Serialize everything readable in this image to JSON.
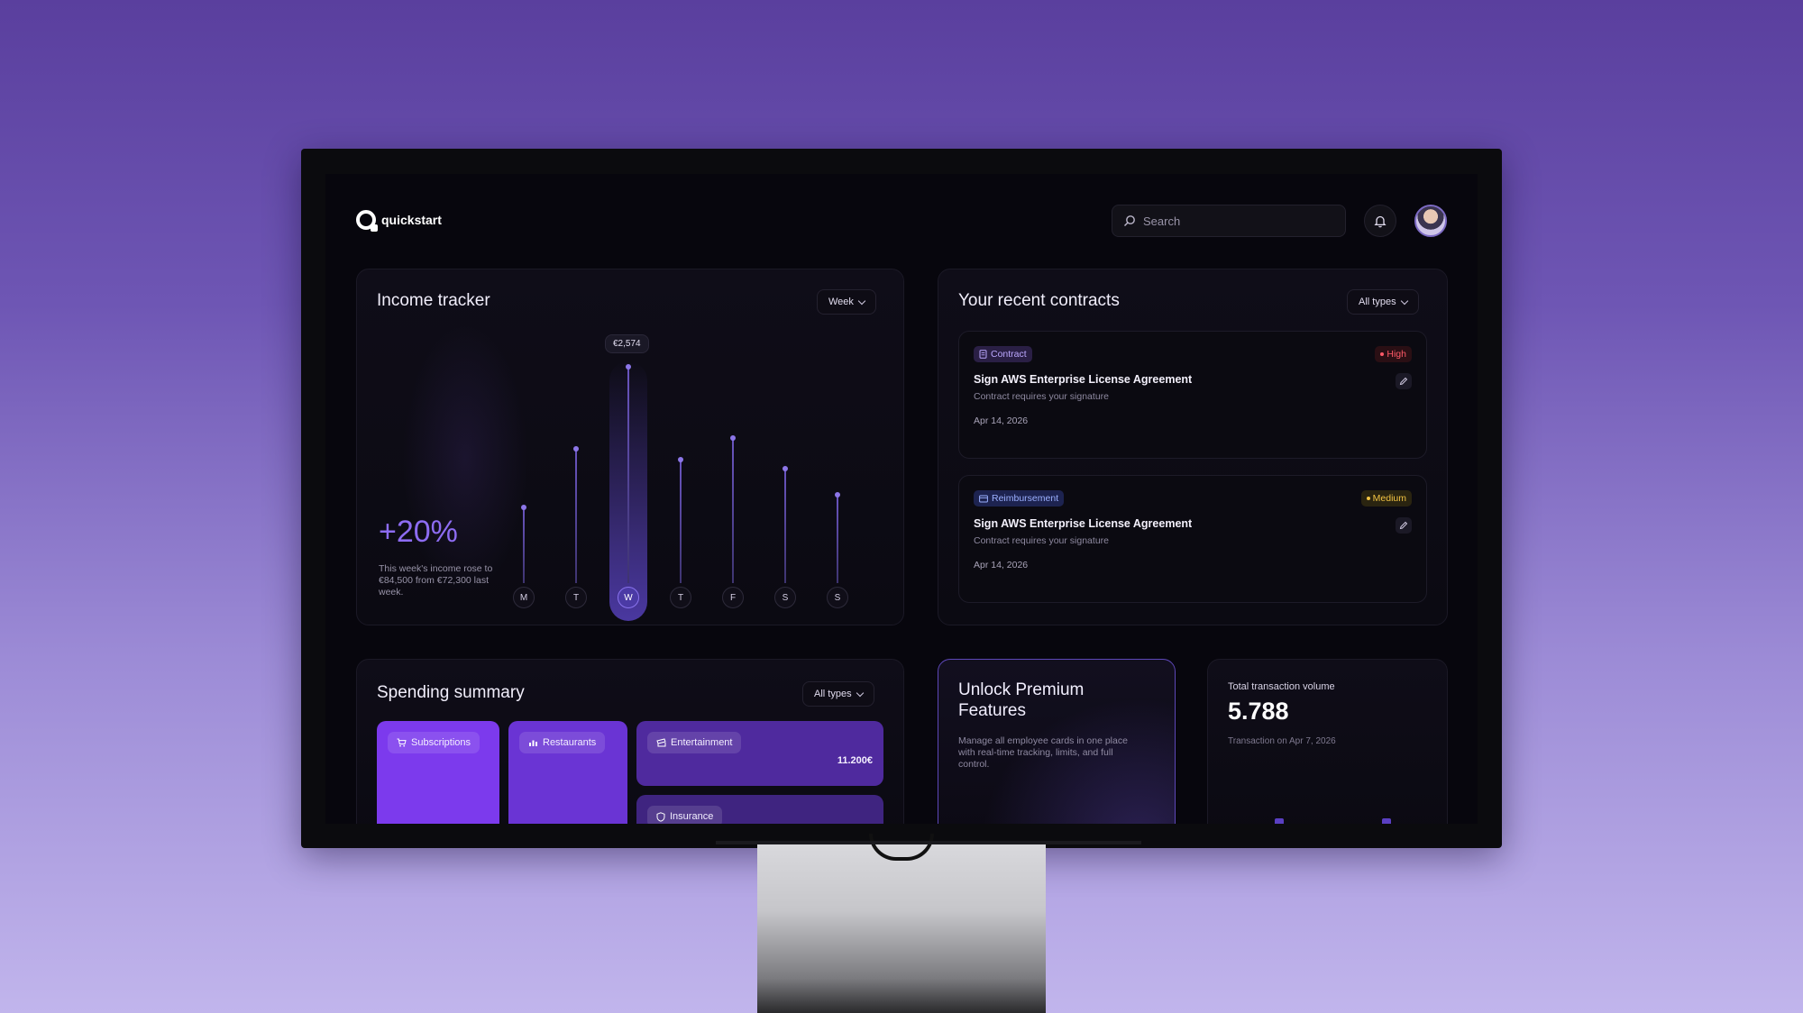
{
  "header": {
    "brand": "quickstart",
    "search_placeholder": "Search"
  },
  "income_tracker": {
    "title": "Income tracker",
    "period": "Week",
    "change": "+20%",
    "description": "This week's income rose to €84,500 from €72,300 last week.",
    "tooltip": "€2,574",
    "days": [
      {
        "label": "M",
        "level": 0.35
      },
      {
        "label": "T",
        "level": 0.62
      },
      {
        "label": "W",
        "level": 1.0,
        "active": true
      },
      {
        "label": "T",
        "level": 0.57
      },
      {
        "label": "F",
        "level": 0.67
      },
      {
        "label": "S",
        "level": 0.53
      },
      {
        "label": "S",
        "level": 0.41
      }
    ]
  },
  "contracts": {
    "title": "Your recent contracts",
    "filter": "All types",
    "items": [
      {
        "type": "Contract",
        "priority": "High",
        "title": "Sign AWS Enterprise License Agreement",
        "subtitle": "Contract requires your signature",
        "date": "Apr 14, 2026"
      },
      {
        "type": "Reimbursement",
        "priority": "Medium",
        "title": "Sign AWS Enterprise License Agreement",
        "subtitle": "Contract requires your signature",
        "date": "Apr 14, 2026"
      }
    ]
  },
  "spending": {
    "title": "Spending summary",
    "filter": "All types",
    "categories": [
      {
        "label": "Subscriptions",
        "value": "",
        "color": "#7c3aed"
      },
      {
        "label": "Restaurants",
        "value": "",
        "color": "#6a34d4"
      },
      {
        "label": "Entertainment",
        "value": "11.200€",
        "color": "#4f2a9e"
      },
      {
        "label": "Insurance",
        "value": "",
        "color": "#3f2480"
      }
    ]
  },
  "premium": {
    "title": "Unlock Premium Features",
    "description": "Manage all employee cards in one place with real-time tracking, limits, and full control."
  },
  "volume": {
    "label": "Total transaction volume",
    "value": "5.788",
    "subtitle": "Transaction on Apr 7, 2026"
  },
  "colors": {
    "accent": "#8d6cf2",
    "high": "#ff5a68",
    "medium": "#f2c343"
  }
}
